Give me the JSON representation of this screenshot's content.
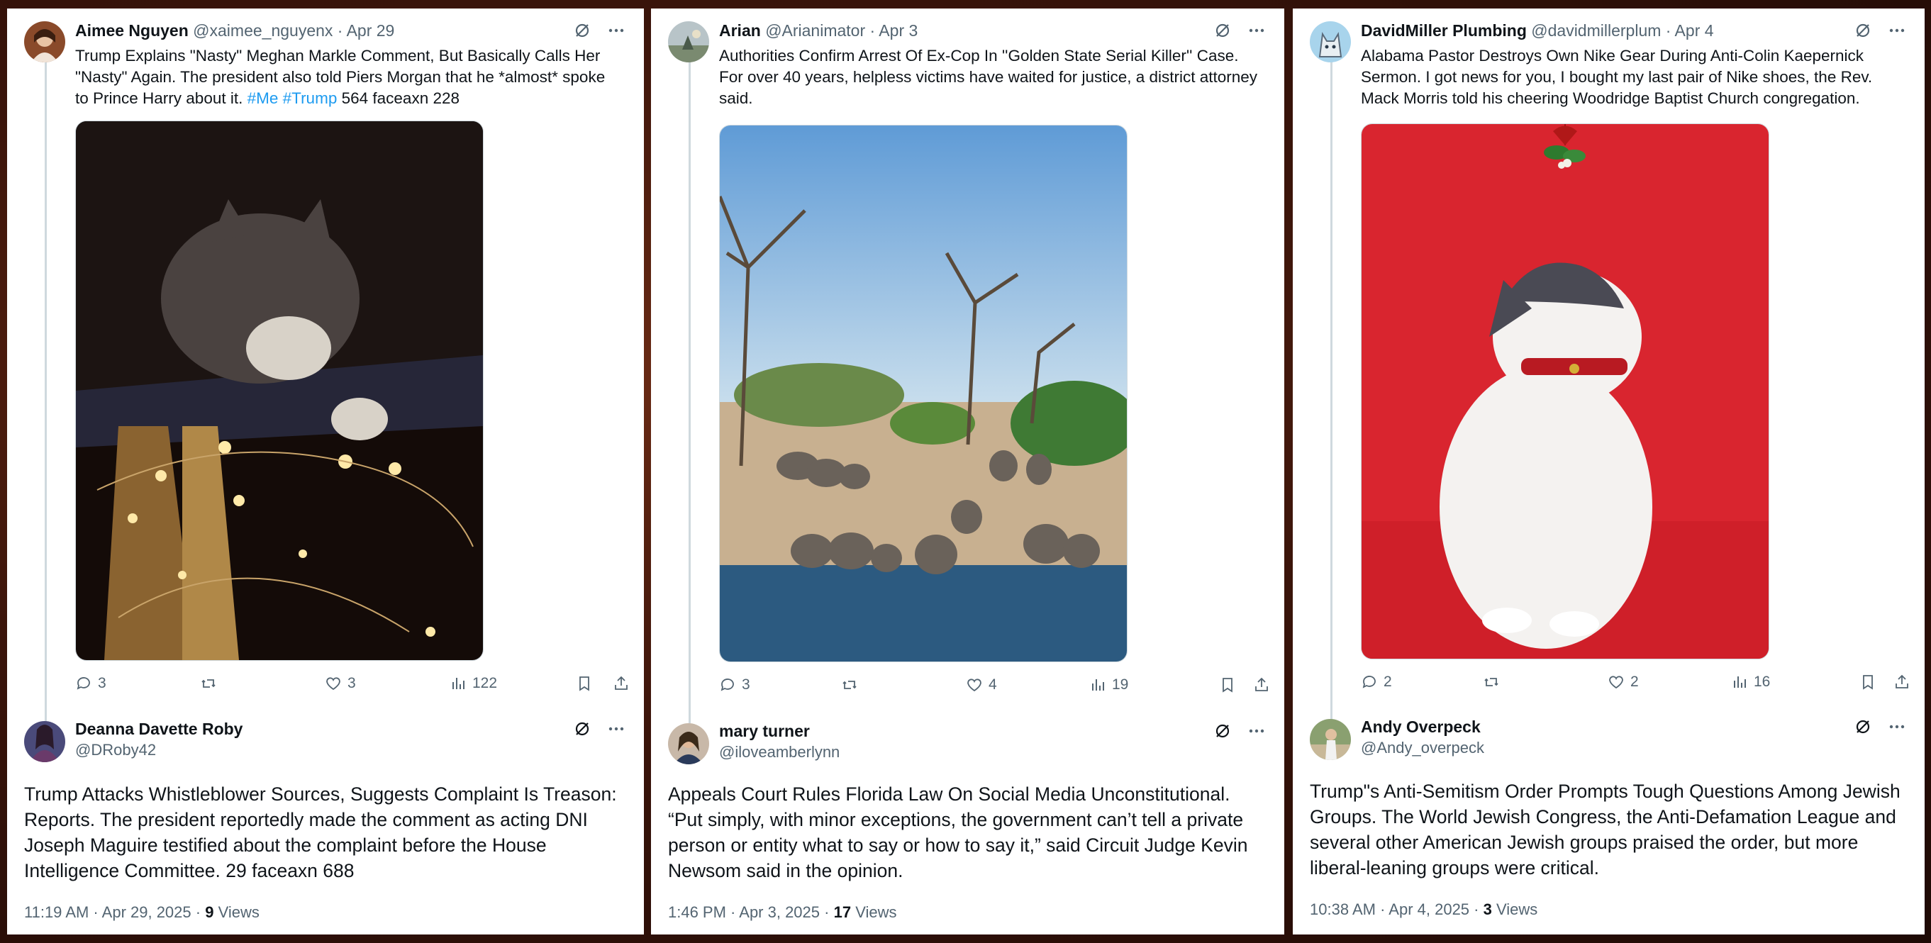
{
  "tweets": [
    {
      "name": "Aimee Nguyen",
      "handle": "@xaimee_nguyenx",
      "date": "· Apr 29",
      "text": "Trump Explains \"Nasty\" Meghan Markle Comment, But Basically Calls Her \"Nasty\" Again. The president also told Piers Morgan that he *almost* spoke to Prince Harry about it.",
      "hashtags": "#Me #Trump",
      "suffix": "564 faceaxn 228",
      "media_icon": "cat-with-string-lights-photo",
      "replies": "3",
      "retweets": "",
      "likes": "3",
      "views": "122"
    },
    {
      "name": "Arian",
      "handle": "@Arianimator",
      "date": "· Apr 3",
      "text": "Authorities Confirm Arrest Of Ex-Cop In ''Golden State Serial Killer'' Case. For over 40 years, helpless victims have waited for justice, a district attorney said.",
      "hashtags": "",
      "suffix": "",
      "media_icon": "elephants-at-waterhole-photo",
      "replies": "3",
      "retweets": "",
      "likes": "4",
      "views": "19"
    },
    {
      "name": "DavidMiller Plumbing",
      "handle": "@davidmillerplum",
      "date": "· Apr 4",
      "text": "Alabama Pastor Destroys Own Nike Gear During Anti-Colin Kaepernick Sermon. I got news for you, I bought my last pair of Nike shoes, the Rev. Mack Morris told his cheering Woodridge Baptist Church congregation.",
      "hashtags": "",
      "suffix": "",
      "media_icon": "cat-under-mistletoe-photo",
      "replies": "2",
      "retweets": "",
      "likes": "2",
      "views": "16"
    }
  ],
  "replies": [
    {
      "name": "Deanna Davette Roby",
      "handle": "@DRoby42",
      "text": "Trump Attacks Whistleblower Sources, Suggests Complaint Is Treason: Reports. The president reportedly made the comment as acting DNI Joseph Maguire testified about the complaint before the House Intelligence Committee. 29 faceaxn 688",
      "time": "11:19 AM · Apr 29, 2025 ·",
      "views_count": "9",
      "views_label": "Views"
    },
    {
      "name": "mary turner",
      "handle": "@iloveamberlynn",
      "text": "Appeals Court Rules Florida Law On Social Media Unconstitutional. “Put simply, with minor exceptions, the government can’t tell a private person or entity what to say or how to say it,” said Circuit Judge Kevin Newsom said in the opinion.",
      "time": "1:46 PM · Apr 3, 2025 ·",
      "views_count": "17",
      "views_label": "Views"
    },
    {
      "name": "Andy Overpeck",
      "handle": "@Andy_overpeck",
      "text": "Trump\"s Anti-Semitism Order Prompts Tough Questions Among Jewish Groups. The World Jewish Congress, the Anti-Defamation League and several other American Jewish groups praised the order, but more liberal-leaning groups were critical.",
      "time": "10:38 AM · Apr 4, 2025 ·",
      "views_count": "3",
      "views_label": "Views"
    }
  ],
  "colors": {
    "link": "#1d9bf0",
    "muted": "#536471",
    "text": "#0f1419"
  }
}
